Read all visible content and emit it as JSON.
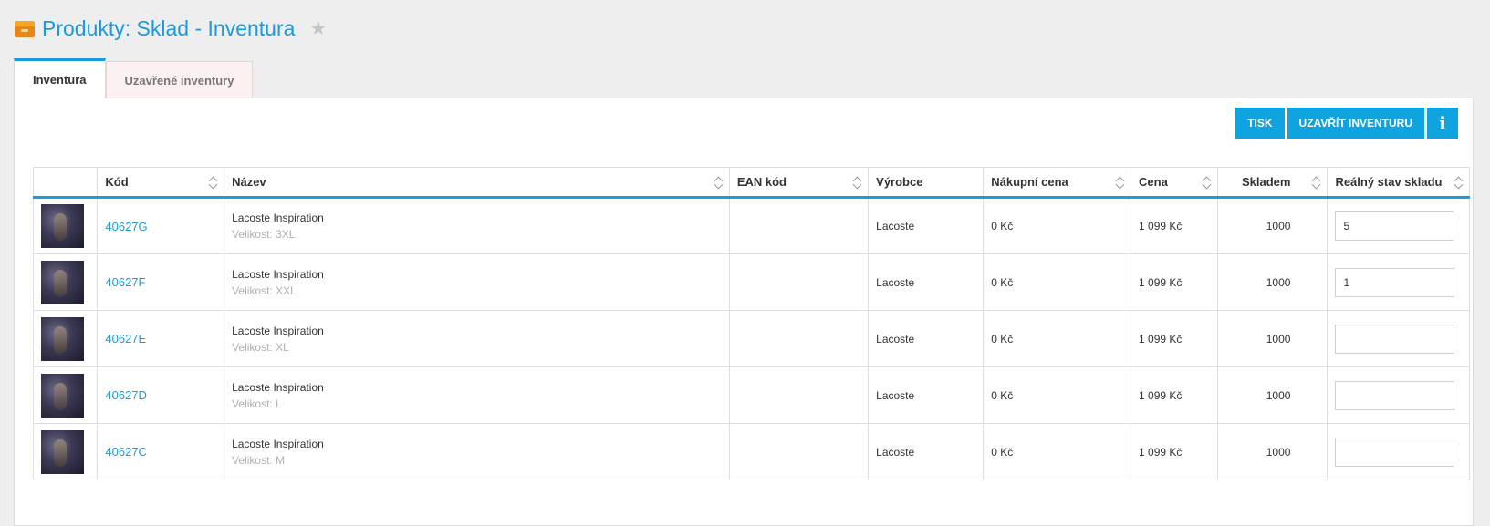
{
  "header": {
    "title": "Produkty: Sklad - Inventura",
    "star_glyph": "★"
  },
  "tabs": [
    {
      "label": "Inventura",
      "active": true
    },
    {
      "label": "Uzavřené inventury",
      "active": false
    }
  ],
  "actions": {
    "print_label": "TISK",
    "close_label": "UZAVŘÍT INVENTURU",
    "info_label": "i"
  },
  "table": {
    "columns": [
      "",
      "Kód",
      "Název",
      "EAN kód",
      "Výrobce",
      "Nákupní cena",
      "Cena",
      "Skladem",
      "Reálný stav skladu"
    ],
    "rows": [
      {
        "code": "40627G",
        "name": "Lacoste Inspiration",
        "variant": "Velikost: 3XL",
        "ean": "",
        "manufacturer": "Lacoste",
        "purchase_price": "0 Kč",
        "price": "1 099 Kč",
        "stock": "1000",
        "real_stock": "5"
      },
      {
        "code": "40627F",
        "name": "Lacoste Inspiration",
        "variant": "Velikost: XXL",
        "ean": "",
        "manufacturer": "Lacoste",
        "purchase_price": "0 Kč",
        "price": "1 099 Kč",
        "stock": "1000",
        "real_stock": "1"
      },
      {
        "code": "40627E",
        "name": "Lacoste Inspiration",
        "variant": "Velikost: XL",
        "ean": "",
        "manufacturer": "Lacoste",
        "purchase_price": "0 Kč",
        "price": "1 099 Kč",
        "stock": "1000",
        "real_stock": ""
      },
      {
        "code": "40627D",
        "name": "Lacoste Inspiration",
        "variant": "Velikost: L",
        "ean": "",
        "manufacturer": "Lacoste",
        "purchase_price": "0 Kč",
        "price": "1 099 Kč",
        "stock": "1000",
        "real_stock": ""
      },
      {
        "code": "40627C",
        "name": "Lacoste Inspiration",
        "variant": "Velikost: M",
        "ean": "",
        "manufacturer": "Lacoste",
        "purchase_price": "0 Kč",
        "price": "1 099 Kč",
        "stock": "1000",
        "real_stock": ""
      }
    ]
  },
  "colors": {
    "accent": "#1a9be0",
    "button": "#0fa3df",
    "background": "#eeeeee"
  }
}
